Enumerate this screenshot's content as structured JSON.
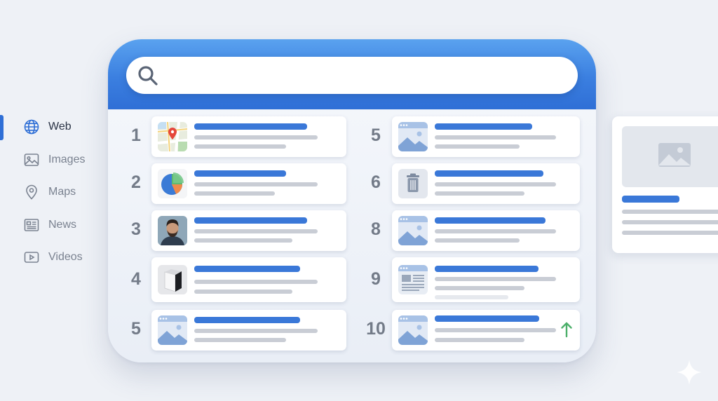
{
  "side_nav": {
    "items": [
      {
        "label": "Web",
        "icon": "globe-icon",
        "active": true
      },
      {
        "label": "Images",
        "icon": "image-icon",
        "active": false
      },
      {
        "label": "Maps",
        "icon": "map-pin-icon",
        "active": false
      },
      {
        "label": "News",
        "icon": "news-icon",
        "active": false
      },
      {
        "label": "Videos",
        "icon": "video-play-icon",
        "active": false
      }
    ]
  },
  "search": {
    "value": "",
    "placeholder": "",
    "icon": "search-icon"
  },
  "results": [
    {
      "rank": "1",
      "thumbnail": "map-thumbnail"
    },
    {
      "rank": "2",
      "thumbnail": "pie-chart-thumbnail"
    },
    {
      "rank": "3",
      "thumbnail": "person-photo-thumbnail"
    },
    {
      "rank": "4",
      "thumbnail": "product-photo-thumbnail"
    },
    {
      "rank": "5",
      "thumbnail": "image-placeholder-thumbnail"
    },
    {
      "rank": "5",
      "thumbnail": "image-placeholder-thumbnail"
    },
    {
      "rank": "6",
      "thumbnail": "trash-icon-thumbnail"
    },
    {
      "rank": "8",
      "thumbnail": "image-placeholder-thumbnail"
    },
    {
      "rank": "9",
      "thumbnail": "document-thumbnail"
    },
    {
      "rank": "10",
      "thumbnail": "image-placeholder-thumbnail",
      "trend": "up-arrow-icon"
    }
  ],
  "preview": {
    "image": "image-placeholder-icon"
  },
  "colors": {
    "accent": "#2f6fd6",
    "header_gradient_top": "#5aa2ef",
    "title_bar": "#3a78d8",
    "text_line": "#c9cdd5",
    "rank_number": "#737b88",
    "trend_up": "#4caf6a",
    "background": "#eef1f6"
  }
}
